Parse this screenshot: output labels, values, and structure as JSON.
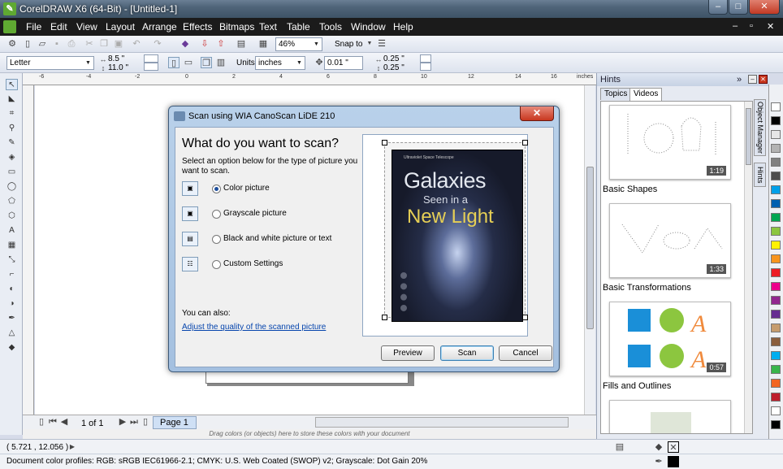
{
  "window": {
    "title": "CorelDRAW X6 (64-Bit) - [Untitled-1]"
  },
  "menu": [
    "File",
    "Edit",
    "View",
    "Layout",
    "Arrange",
    "Effects",
    "Bitmaps",
    "Text",
    "Table",
    "Tools",
    "Window",
    "Help"
  ],
  "toolbar": {
    "zoom": "46%",
    "snap_label": "Snap to"
  },
  "propbar": {
    "page_size": "Letter",
    "width": "8.5 \"",
    "height": "11.0 \"",
    "units_label": "Units:",
    "units": "inches",
    "nudge": "0.01 \"",
    "dup_x": "0.25 \"",
    "dup_y": "0.25 \""
  },
  "ruler": {
    "units": "inches",
    "h_ticks": [
      "-6",
      "-4",
      "-2",
      "0",
      "2",
      "4",
      "6",
      "8",
      "10",
      "12",
      "14",
      "16"
    ]
  },
  "page_nav": {
    "count": "1 of 1",
    "page_tab": "Page 1"
  },
  "color_hint": "Drag colors (or objects) here to store these colors with your document",
  "status": {
    "coords": "( 5.721 , 12.056 )",
    "profiles": "Document color profiles: RGB: sRGB IEC61966-2.1; CMYK: U.S. Web Coated (SWOP) v2; Grayscale: Dot Gain 20%"
  },
  "docker": {
    "title": "Hints",
    "tabs": [
      "Topics",
      "Videos"
    ],
    "side_tabs": [
      "Object Manager",
      "Hints"
    ],
    "videos": [
      {
        "title": "Basic Shapes",
        "duration": "1:19"
      },
      {
        "title": "Basic Transformations",
        "duration": "1:33"
      },
      {
        "title": "Fills and Outlines",
        "duration": "0:57"
      }
    ]
  },
  "dialog": {
    "title": "Scan using WIA CanoScan LiDE 210",
    "heading": "What do you want to scan?",
    "subtext": "Select an option below for the type of picture you want to scan.",
    "options": [
      {
        "label": "Color picture",
        "selected": true
      },
      {
        "label": "Grayscale picture",
        "selected": false
      },
      {
        "label": "Black and white picture or text",
        "selected": false
      },
      {
        "label": "Custom Settings",
        "selected": false
      }
    ],
    "also_label": "You can also:",
    "adjust_link": "Adjust the quality of the scanned picture",
    "buttons": {
      "preview": "Preview",
      "scan": "Scan",
      "cancel": "Cancel"
    },
    "preview_image": {
      "kicker": "Ultraviolet Space Telescope",
      "line1": "Galaxies",
      "line2": "Seen in a",
      "line3": "New Light"
    }
  },
  "palette_colors": [
    "#ffffff",
    "#000000",
    "#e6e6e6",
    "#b3b3b3",
    "#808080",
    "#4d4d4d",
    "#00a0e9",
    "#0060b0",
    "#00a651",
    "#8cc63f",
    "#fff200",
    "#f7941d",
    "#ed1c24",
    "#ec008c",
    "#92278f",
    "#662d91",
    "#c69c6d",
    "#8b5e3c",
    "#00aeef",
    "#39b54a",
    "#f26522",
    "#be1e2d",
    "#ffffff",
    "#000000"
  ]
}
